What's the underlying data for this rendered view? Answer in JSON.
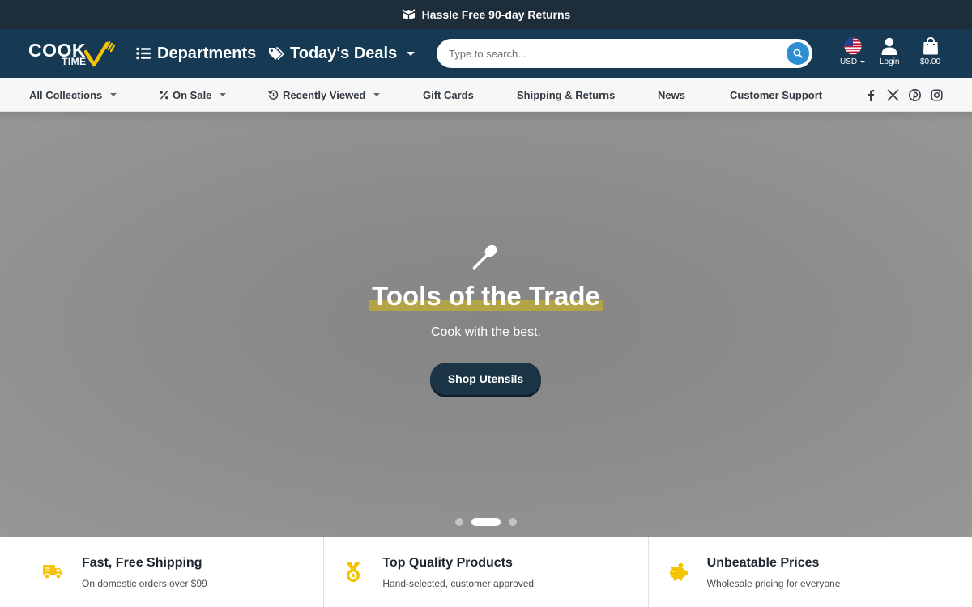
{
  "announcement": {
    "text": "Hassle Free 90-day Returns"
  },
  "header": {
    "logo_main": "COOK",
    "logo_sub": "TIME",
    "departments_label": "Departments",
    "deals_label": "Today's Deals",
    "search_placeholder": "Type to search...",
    "currency_label": "USD",
    "login_label": "Login",
    "cart_label": "$0.00"
  },
  "subnav": {
    "all_collections": "All Collections",
    "on_sale": "On Sale",
    "recently_viewed": "Recently Viewed",
    "gift_cards": "Gift Cards",
    "shipping_returns": "Shipping & Returns",
    "news": "News",
    "customer_support": "Customer Support"
  },
  "hero": {
    "title": "Tools of the Trade",
    "subtitle": "Cook with the best.",
    "button_label": "Shop Utensils",
    "slides_total": 3,
    "active_slide": 2
  },
  "features": [
    {
      "title": "Fast, Free Shipping",
      "desc": "On domestic orders over $99",
      "icon": "truck-icon"
    },
    {
      "title": "Top Quality Products",
      "desc": "Hand-selected, customer approved",
      "icon": "medal-icon"
    },
    {
      "title": "Unbeatable Prices",
      "desc": "Wholesale pricing for everyone",
      "icon": "piggy-bank-icon"
    }
  ],
  "colors": {
    "announcement_bg": "#1e2d3a",
    "header_bg": "#163a54",
    "accent_yellow": "#f4c400",
    "search_button": "#2d8fd0",
    "hero_button": "#1b3547"
  }
}
